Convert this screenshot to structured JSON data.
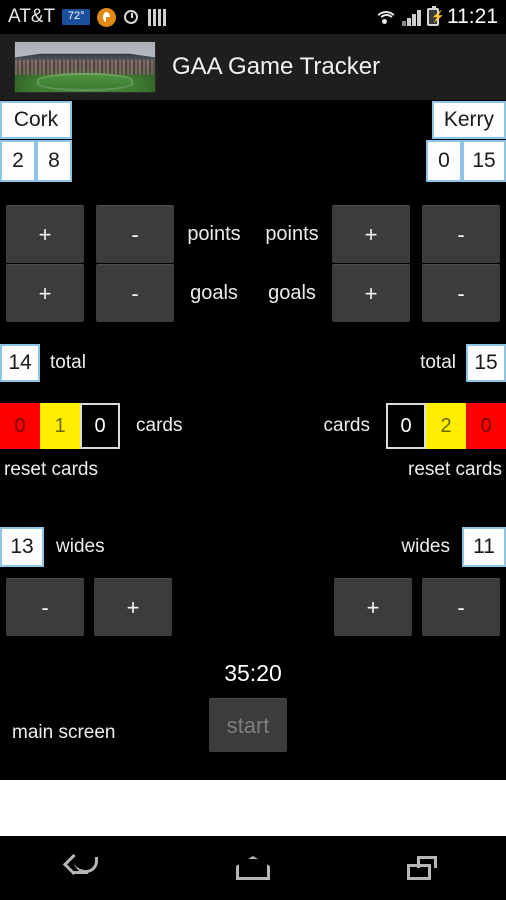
{
  "status_bar": {
    "carrier": "AT&T",
    "weather_badge": "72°",
    "time": "11:21",
    "icons": [
      "sync-circle-icon",
      "alarm-clock-icon",
      "signal-bars-icon",
      "wifi-icon",
      "cell-signal-icon",
      "battery-charging-icon"
    ]
  },
  "app": {
    "title": "GAA Game Tracker",
    "logo_alt": "stadium-photo"
  },
  "teams": {
    "home": {
      "name": "Cork",
      "goals": "2",
      "points": "8",
      "total_label": "total",
      "total": "14",
      "points_label": "points",
      "goals_label": "goals",
      "plus_label": "+",
      "minus_label": "-",
      "cards_label": "cards",
      "cards": {
        "red": "0",
        "yellow": "1",
        "black": "0"
      },
      "reset_cards_label": "reset cards",
      "wides_label": "wides",
      "wides": "13"
    },
    "away": {
      "name": "Kerry",
      "goals": "0",
      "points": "15",
      "total_label": "total",
      "total": "15",
      "points_label": "points",
      "goals_label": "goals",
      "plus_label": "+",
      "minus_label": "-",
      "cards_label": "cards",
      "cards": {
        "black": "0",
        "yellow": "2",
        "red": "0"
      },
      "reset_cards_label": "reset cards",
      "wides_label": "wides",
      "wides": "11"
    }
  },
  "timer": {
    "display": "35:20",
    "start_label": "start",
    "main_screen_label": "main screen"
  },
  "nav_bar": {
    "back": "back-icon",
    "home": "home-icon",
    "recents": "recents-icon"
  },
  "colors": {
    "accent_border": "#8ec4e8",
    "button_bg": "#3c3c3c",
    "card_red": "#fe0000",
    "card_yellow": "#ffee00",
    "card_black": "#000000",
    "header_bg": "#1e1e1e"
  }
}
